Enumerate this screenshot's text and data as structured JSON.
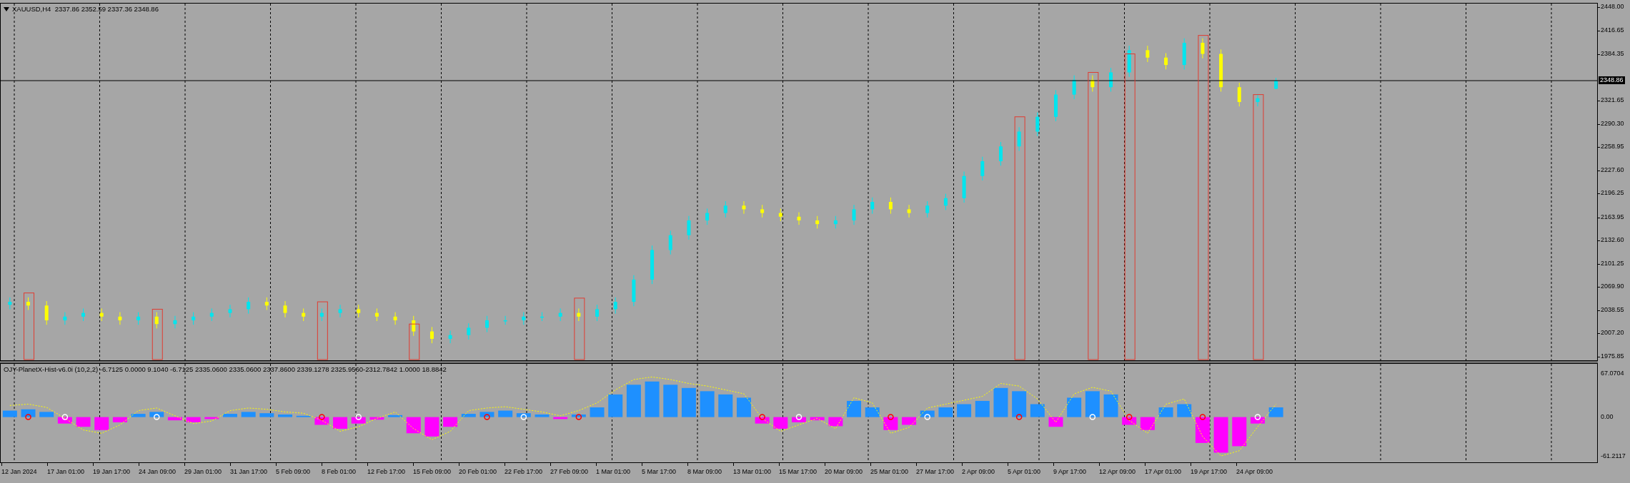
{
  "main_chart": {
    "header": "XAUUSD,H4  2337.86 2352.59 2337.36 2348.86",
    "current_price": "2348.86",
    "chart_data": {
      "type": "candlestick",
      "ylim": [
        1971,
        2453
      ],
      "grid": true,
      "yticks": [
        {
          "value": 2448,
          "label": "2448.00"
        },
        {
          "value": 2416.65,
          "label": "2416.65"
        },
        {
          "value": 2384.35,
          "label": "2384.35"
        },
        {
          "value": 2321.65,
          "label": "2321.65"
        },
        {
          "value": 2290.3,
          "label": "2290.30"
        },
        {
          "value": 2258.95,
          "label": "2258.95"
        },
        {
          "value": 2227.6,
          "label": "2227.60"
        },
        {
          "value": 2196.25,
          "label": "2196.25"
        },
        {
          "value": 2163.95,
          "label": "2163.95"
        },
        {
          "value": 2132.6,
          "label": "2132.60"
        },
        {
          "value": 2101.25,
          "label": "2101.25"
        },
        {
          "value": 2069.9,
          "label": "2069.90"
        },
        {
          "value": 2038.55,
          "label": "2038.55"
        },
        {
          "value": 2007.2,
          "label": "2007.20"
        },
        {
          "value": 1975.85,
          "label": "1975.85"
        }
      ],
      "categories": [
        null,
        null,
        null,
        null,
        null,
        null,
        null,
        null,
        null,
        null,
        null,
        null,
        null,
        null,
        null,
        null,
        null,
        null,
        null,
        null,
        null,
        null,
        null,
        null,
        null,
        null,
        null,
        null,
        null,
        null,
        null,
        null,
        null,
        null,
        null,
        null,
        null,
        null,
        null,
        null,
        null,
        null,
        null,
        null,
        null,
        null,
        null,
        null,
        null,
        null,
        null,
        null,
        null,
        null,
        null,
        null,
        null,
        null,
        null,
        null,
        null,
        null,
        null,
        null,
        null,
        null,
        null,
        null,
        null,
        null,
        null,
        null,
        null,
        null,
        null,
        null,
        null,
        null,
        null,
        null,
        null,
        null,
        null,
        null,
        null,
        null,
        null
      ],
      "ohlc": [
        [
          2046,
          2056,
          2040,
          2050
        ],
        [
          2050,
          2056,
          2039,
          2045
        ],
        [
          2045,
          2051,
          2019,
          2025
        ],
        [
          2025,
          2036,
          2019,
          2030
        ],
        [
          2030,
          2041,
          2024,
          2035
        ],
        [
          2035,
          2041,
          2024,
          2030
        ],
        [
          2030,
          2036,
          2019,
          2025
        ],
        [
          2025,
          2036,
          2019,
          2030
        ],
        [
          2030,
          2036,
          2014,
          2020
        ],
        [
          2020,
          2031,
          2014,
          2025
        ],
        [
          2025,
          2036,
          2019,
          2030
        ],
        [
          2030,
          2041,
          2024,
          2035
        ],
        [
          2035,
          2046,
          2029,
          2040
        ],
        [
          2040,
          2056,
          2034,
          2050
        ],
        [
          2050,
          2056,
          2039,
          2045
        ],
        [
          2045,
          2051,
          2029,
          2035
        ],
        [
          2035,
          2041,
          2024,
          2030
        ],
        [
          2030,
          2041,
          2024,
          2035
        ],
        [
          2035,
          2046,
          2029,
          2040
        ],
        [
          2040,
          2046,
          2029,
          2035
        ],
        [
          2035,
          2041,
          2024,
          2030
        ],
        [
          2030,
          2036,
          2019,
          2025
        ],
        [
          2025,
          2031,
          2004,
          2010
        ],
        [
          2010,
          2016,
          1994,
          2000
        ],
        [
          2000,
          2011,
          1994,
          2005
        ],
        [
          2005,
          2021,
          1999,
          2015
        ],
        [
          2015,
          2031,
          2009,
          2025
        ],
        [
          2025,
          2031,
          2019,
          2025
        ],
        [
          2025,
          2036,
          2019,
          2030
        ],
        [
          2030,
          2036,
          2024,
          2030
        ],
        [
          2030,
          2041,
          2024,
          2035
        ],
        [
          2035,
          2041,
          2024,
          2030
        ],
        [
          2030,
          2046,
          2024,
          2040
        ],
        [
          2040,
          2056,
          2034,
          2050
        ],
        [
          2050,
          2086,
          2044,
          2080
        ],
        [
          2080,
          2126,
          2074,
          2120
        ],
        [
          2120,
          2146,
          2114,
          2140
        ],
        [
          2140,
          2166,
          2134,
          2160
        ],
        [
          2160,
          2176,
          2154,
          2170
        ],
        [
          2170,
          2186,
          2164,
          2180
        ],
        [
          2180,
          2186,
          2169,
          2175
        ],
        [
          2175,
          2181,
          2164,
          2170
        ],
        [
          2170,
          2176,
          2159,
          2165
        ],
        [
          2165,
          2171,
          2154,
          2160
        ],
        [
          2160,
          2166,
          2149,
          2155
        ],
        [
          2155,
          2166,
          2149,
          2160
        ],
        [
          2160,
          2181,
          2154,
          2175
        ],
        [
          2175,
          2191,
          2169,
          2185
        ],
        [
          2185,
          2191,
          2169,
          2175
        ],
        [
          2175,
          2181,
          2164,
          2170
        ],
        [
          2170,
          2186,
          2164,
          2180
        ],
        [
          2180,
          2196,
          2174,
          2190
        ],
        [
          2190,
          2226,
          2184,
          2220
        ],
        [
          2220,
          2246,
          2214,
          2240
        ],
        [
          2240,
          2266,
          2234,
          2260
        ],
        [
          2260,
          2286,
          2254,
          2280
        ],
        [
          2280,
          2306,
          2274,
          2300
        ],
        [
          2300,
          2336,
          2294,
          2330
        ],
        [
          2330,
          2356,
          2324,
          2350
        ],
        [
          2350,
          2356,
          2334,
          2340
        ],
        [
          2340,
          2366,
          2334,
          2360
        ],
        [
          2360,
          2396,
          2354,
          2390
        ],
        [
          2390,
          2396,
          2374,
          2380
        ],
        [
          2380,
          2386,
          2364,
          2370
        ],
        [
          2370,
          2406,
          2364,
          2400
        ],
        [
          2400,
          2406,
          2379,
          2385
        ],
        [
          2385,
          2391,
          2334,
          2340
        ],
        [
          2340,
          2346,
          2314,
          2320
        ],
        [
          2320,
          2331,
          2314,
          2325
        ],
        [
          2337.86,
          2352.59,
          2337.36,
          2348.86
        ],
        null,
        null,
        null,
        null,
        null,
        null,
        null,
        null,
        null,
        null,
        null,
        null,
        null,
        null,
        null,
        null,
        null
      ]
    }
  },
  "indicator": {
    "label": "OJY-PlanetX-Hist-v6.0i (10,2,2) -6.7125 0.0000 9.1040 -6.7125 2335.0600 2335.0600 2337.8600 2339.1278 2325.9560-2312.7842 1.0000 18.8842",
    "chart_data": {
      "type": "bar",
      "ylim": [
        -69.91,
        82.29
      ],
      "grid": true,
      "yticks": [
        {
          "value": 67.0704,
          "label": "67.0704"
        },
        {
          "value": 0,
          "label": "0.00"
        },
        {
          "value": -61.2117,
          "label": "-61.2117"
        }
      ],
      "categories": [
        null,
        null,
        null,
        null,
        null,
        null,
        null,
        null,
        null,
        null,
        null,
        null,
        null,
        null,
        null,
        null,
        null,
        null,
        null,
        null,
        null,
        null,
        null,
        null,
        null,
        null,
        null,
        null,
        null,
        null,
        null,
        null,
        null,
        null,
        null,
        null,
        null,
        null,
        null,
        null,
        null,
        null,
        null,
        null,
        null,
        null,
        null,
        null,
        null,
        null,
        null,
        null,
        null,
        null,
        null,
        null,
        null,
        null,
        null,
        null,
        null,
        null,
        null,
        null,
        null,
        null,
        null,
        null,
        null,
        null,
        null,
        null,
        null,
        null,
        null,
        null,
        null,
        null,
        null,
        null,
        null,
        null,
        null,
        null,
        null,
        null,
        null
      ],
      "series": [
        {
          "type": "bar",
          "color": "#1e90ff",
          "values": [
            10,
            12,
            8,
            null,
            null,
            null,
            null,
            5,
            8,
            null,
            null,
            null,
            5,
            8,
            6,
            4,
            2,
            null,
            null,
            null,
            null,
            3,
            null,
            null,
            null,
            5,
            8,
            10,
            6,
            4,
            null,
            4,
            15,
            35,
            50,
            55,
            50,
            45,
            40,
            35,
            30,
            null,
            null,
            null,
            null,
            null,
            25,
            15,
            null,
            null,
            10,
            15,
            20,
            25,
            45,
            40,
            20,
            null,
            30,
            40,
            35,
            null,
            null,
            15,
            20,
            null,
            null,
            null,
            null,
            15,
            null,
            null,
            null,
            null,
            null,
            null,
            null,
            null,
            null,
            null,
            null,
            null,
            null,
            null,
            null,
            null,
            null
          ]
        },
        {
          "type": "bar",
          "color": "#ff00ff",
          "values": [
            null,
            null,
            null,
            -10,
            -15,
            -20,
            -8,
            null,
            null,
            -5,
            -8,
            -3,
            null,
            null,
            null,
            null,
            null,
            -12,
            -18,
            -10,
            -4,
            null,
            -25,
            -30,
            -15,
            null,
            null,
            null,
            null,
            null,
            -3,
            null,
            null,
            null,
            null,
            null,
            null,
            null,
            null,
            null,
            null,
            -10,
            -18,
            -8,
            -5,
            -14,
            null,
            null,
            -20,
            -12,
            null,
            null,
            null,
            null,
            null,
            null,
            null,
            -15,
            null,
            null,
            null,
            -12,
            -20,
            null,
            null,
            -40,
            -55,
            -45,
            -10,
            null,
            null,
            null,
            null,
            null,
            null,
            null,
            null,
            null,
            null,
            null,
            null,
            null,
            null,
            null,
            null,
            null,
            null
          ]
        },
        {
          "type": "line",
          "line_style": "dashed",
          "color": "#ffff00",
          "values": [
            18,
            20,
            15,
            -2,
            -20,
            -25,
            -12,
            10,
            14,
            2,
            -10,
            -6,
            10,
            14,
            12,
            8,
            6,
            -5,
            -22,
            -15,
            -2,
            8,
            -18,
            -35,
            -22,
            10,
            14,
            16,
            12,
            8,
            2,
            10,
            22,
            42,
            58,
            62,
            58,
            52,
            48,
            42,
            36,
            -2,
            -22,
            -12,
            -2,
            -18,
            30,
            22,
            -25,
            -16,
            14,
            20,
            26,
            32,
            52,
            48,
            28,
            -8,
            36,
            46,
            40,
            -5,
            -25,
            20,
            28,
            -30,
            -60,
            -52,
            -15,
            20,
            null,
            null,
            null,
            null,
            null,
            null,
            null,
            null,
            null,
            null,
            null,
            null,
            null,
            null,
            null,
            null,
            null
          ]
        }
      ]
    },
    "markers": [
      {
        "color": "#ff0000"
      },
      {
        "color": "#ffffff"
      },
      {
        "color": "#ffffff"
      },
      {
        "color": "#ff0000"
      },
      {
        "color": "#ffffff"
      },
      {
        "color": "#ff0000"
      },
      {
        "color": "#ffffff"
      },
      {
        "color": "#ff0000"
      },
      {
        "color": "#ff0000"
      },
      {
        "color": "#ffffff"
      },
      {
        "color": "#ff0000"
      },
      {
        "color": "#ffffff"
      },
      {
        "color": "#ff0000"
      },
      {
        "color": "#ffffff"
      },
      {
        "color": "#ff0000"
      },
      {
        "color": "#ff0000"
      },
      {
        "color": "#ffffff"
      }
    ]
  },
  "time_axis": [
    "12 Jan 2024",
    "17 Jan 01:00",
    "19 Jan 17:00",
    "24 Jan 09:00",
    "29 Jan 01:00",
    "31 Jan 17:00",
    "5 Feb 09:00",
    "8 Feb 01:00",
    "12 Feb 17:00",
    "15 Feb 09:00",
    "20 Feb 01:00",
    "22 Feb 17:00",
    "27 Feb 09:00",
    "1 Mar 01:00",
    "5 Mar 17:00",
    "8 Mar 09:00",
    "13 Mar 01:00",
    "15 Mar 17:00",
    "20 Mar 09:00",
    "25 Mar 01:00",
    "27 Mar 17:00",
    "2 Apr 09:00",
    "5 Apr 01:00",
    "9 Apr 17:00",
    "12 Apr 09:00",
    "17 Apr 01:00",
    "19 Apr 17:00",
    "24 Apr 09:00"
  ]
}
